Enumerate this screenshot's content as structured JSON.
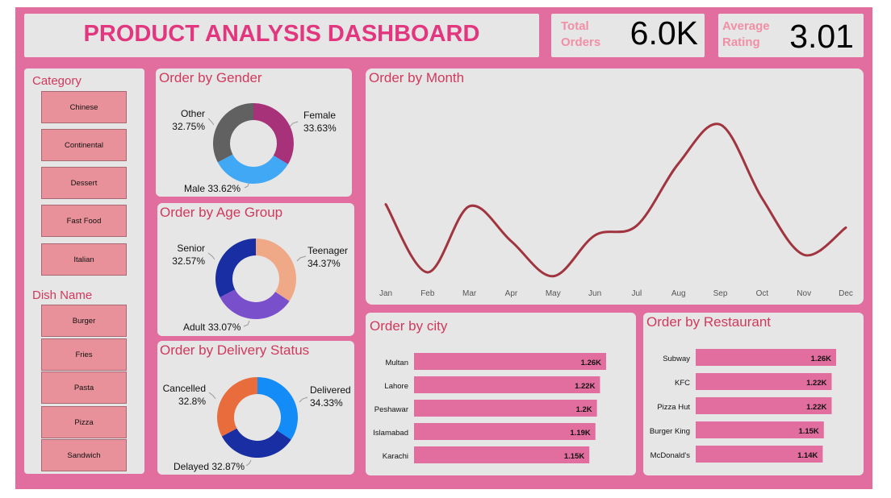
{
  "header": {
    "title": "PRODUCT ANALYSIS DASHBOARD"
  },
  "kpis": {
    "total_orders": {
      "label": "Total Orders",
      "value": "6.0K"
    },
    "average_rating": {
      "label": "Average Rating",
      "value": "3.01"
    }
  },
  "slicers": {
    "category": {
      "title": "Category",
      "items": [
        "Chinese",
        "Continental",
        "Dessert",
        "Fast Food",
        "Italian"
      ]
    },
    "dish_name": {
      "title": "Dish Name",
      "items": [
        "Burger",
        "Fries",
        "Pasta",
        "Pizza",
        "Sandwich"
      ]
    }
  },
  "colors": {
    "background": "#e26ea0",
    "panel": "#e6e6e6",
    "title": "#e2377e",
    "panel_title": "#d1395c",
    "line": "#a0343f",
    "bar": "#e26ea0"
  },
  "chart_data": [
    {
      "id": "gender",
      "type": "pie",
      "title": "Order by Gender",
      "labels": [
        "Female",
        "Male",
        "Other"
      ],
      "display": [
        "33.63%",
        "33.62%",
        "32.75%"
      ],
      "values": [
        33.63,
        33.62,
        32.75
      ],
      "colors": [
        "#a83279",
        "#40a8f5",
        "#616161"
      ]
    },
    {
      "id": "age",
      "type": "pie",
      "title": "Order by Age Group",
      "labels": [
        "Teenager",
        "Adult",
        "Senior"
      ],
      "display": [
        "34.37%",
        "33.07%",
        "32.57%"
      ],
      "values": [
        34.37,
        33.07,
        32.57
      ],
      "colors": [
        "#f0a987",
        "#7a4fcb",
        "#1a2ea3"
      ]
    },
    {
      "id": "delivery",
      "type": "pie",
      "title": "Order by Delivery Status",
      "labels": [
        "Delivered",
        "Delayed",
        "Cancelled"
      ],
      "display": [
        "34.33%",
        "32.87%",
        "32.8%"
      ],
      "values": [
        34.33,
        32.87,
        32.8
      ],
      "colors": [
        "#138cf7",
        "#1a2ea3",
        "#e96d3c"
      ]
    },
    {
      "id": "month",
      "type": "line",
      "title": "Order by Month",
      "categories": [
        "Jan",
        "Feb",
        "Mar",
        "Apr",
        "May",
        "Jun",
        "Jul",
        "Aug",
        "Sep",
        "Oct",
        "Nov",
        "Dec"
      ],
      "values": [
        505,
        470,
        504,
        486,
        468,
        489,
        494,
        526,
        546,
        508,
        479,
        493
      ],
      "ylim": [
        465,
        550
      ]
    },
    {
      "id": "city",
      "type": "bar",
      "orientation": "horizontal",
      "title": "Order by city",
      "categories": [
        "Multan",
        "Lahore",
        "Peshawar",
        "Islamabad",
        "Karachi"
      ],
      "values": [
        1.26,
        1.22,
        1.2,
        1.19,
        1.15
      ],
      "labels": [
        "1.26K",
        "1.22K",
        "1.2K",
        "1.19K",
        "1.15K"
      ]
    },
    {
      "id": "restaurant",
      "type": "bar",
      "orientation": "horizontal",
      "title": "Order by Restaurant",
      "categories": [
        "Subway",
        "KFC",
        "Pizza Hut",
        "Burger King",
        "McDonald's"
      ],
      "values": [
        1.26,
        1.22,
        1.22,
        1.15,
        1.14
      ],
      "labels": [
        "1.26K",
        "1.22K",
        "1.22K",
        "1.15K",
        "1.14K"
      ]
    }
  ]
}
